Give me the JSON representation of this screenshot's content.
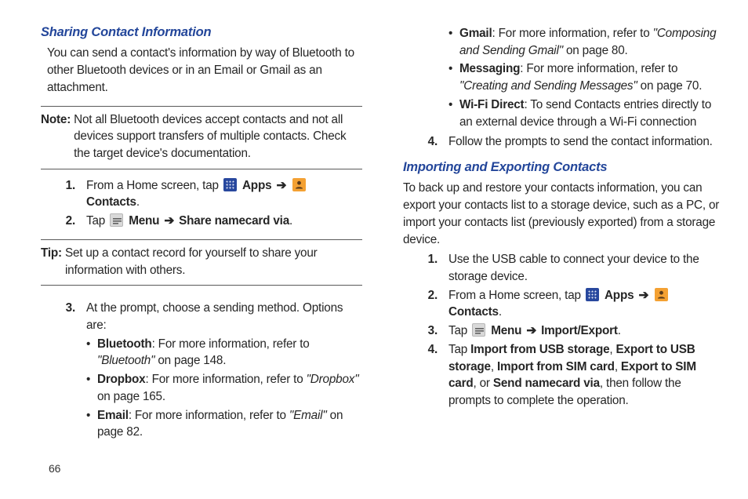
{
  "page_number": "66",
  "left": {
    "heading": "Sharing Contact Information",
    "intro": "You can send a contact's information by way of Bluetooth to other Bluetooth devices or in an Email or Gmail as an attachment.",
    "note_label": "Note:",
    "note_body": "Not all Bluetooth devices accept contacts and not all devices support transfers of multiple contacts. Check the target device's documentation.",
    "step1_num": "1.",
    "step1_a": "From a Home screen, tap ",
    "apps_label": "Apps",
    "arrow": "➔",
    "contacts_label": "Contacts",
    "period": ".",
    "step2_num": "2.",
    "step2_a": "Tap ",
    "menu_label": "Menu",
    "share_via": "Share namecard via",
    "tip_label": "Tip:",
    "tip_body": "Set up a contact record for yourself to share your information with others.",
    "step3_num": "3.",
    "step3_body": "At the prompt, choose a sending method. Options are:",
    "b_bt_label": "Bluetooth",
    "b_bt_rest": ": For more information, refer to ",
    "b_bt_ref": "\"Bluetooth\"",
    "b_bt_tail": "  on page 148.",
    "b_db_label": "Dropbox",
    "b_db_rest": ": For more information, refer to ",
    "b_db_ref": "\"Dropbox\"",
    "b_db_tail": "  on page 165.",
    "b_em_label": "Email",
    "b_em_rest": ": For more information, refer to ",
    "b_em_ref": "\"Email\"",
    "b_em_tail": "  on page 82."
  },
  "right": {
    "b_gm_label": "Gmail",
    "b_gm_rest": ": For more information, refer to ",
    "b_gm_ref": "\"Composing and Sending Gmail\"",
    "b_gm_tail": "  on page 80.",
    "b_ms_label": "Messaging",
    "b_ms_rest": ": For more information, refer to ",
    "b_ms_ref": "\"Creating and Sending Messages\"",
    "b_ms_tail": "  on page 70.",
    "b_wf_label": "Wi-Fi Direct",
    "b_wf_rest": ": To send Contacts entries directly to an external device through a Wi-Fi connection",
    "step4_num": "4.",
    "step4_body": "Follow the prompts to send the contact information.",
    "heading2": "Importing and Exporting Contacts",
    "intro2": "To back up and restore your contacts information, you can export your contacts list to a storage device, such as a PC, or import your contacts list (previously exported) from a storage device.",
    "s1_num": "1.",
    "s1_body": "Use the USB cable to connect your device to the storage device.",
    "s2_num": "2.",
    "s2_a": "From a Home screen, tap ",
    "s3_num": "3.",
    "s3_a": "Tap ",
    "importexport": "Import/Export",
    "s4_num": "4.",
    "s4_a": "Tap ",
    "s4_b1": "Import from USB storage",
    "s4_c": ", ",
    "s4_b2": "Export to USB storage",
    "s4_b3": "Import from SIM card",
    "s4_b4": "Export to SIM card",
    "s4_d": ", or ",
    "s4_b5": "Send namecard via",
    "s4_tail": ", then follow the prompts to complete the operation."
  }
}
